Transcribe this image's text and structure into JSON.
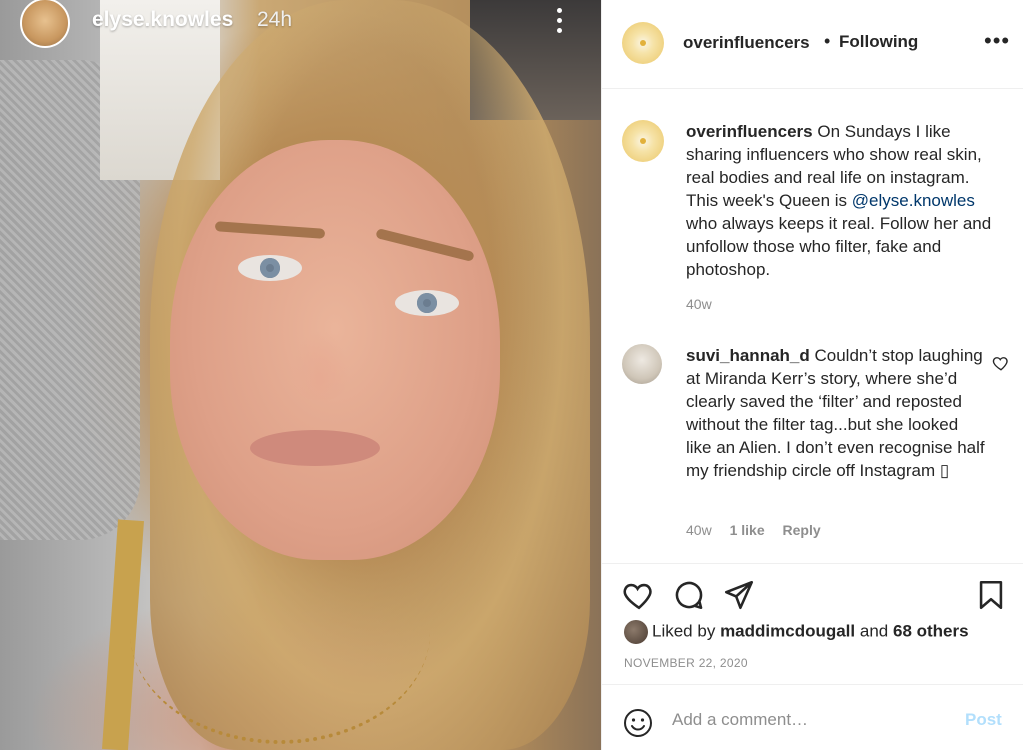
{
  "story": {
    "username": "elyse.knowles",
    "time": "24h",
    "more_icon": "more-vertical-icon"
  },
  "header": {
    "username": "overinfluencers",
    "separator": "•",
    "follow_state": "Following",
    "more_icon": "more-horizontal-icon"
  },
  "caption": {
    "username": "overinfluencers",
    "text_before": "On Sundays I like sharing influencers who show real skin, real bodies and real life on instagram. This week's Queen is",
    "mention": "@elyse.knowles",
    "text_after": "who always keeps it real. Follow her and unfollow those who filter, fake and photoshop.",
    "time": "40w"
  },
  "comment": {
    "username": "suvi_hannah_d",
    "text": "Couldn’t stop laughing at Miranda Kerr’s story, where she’d clearly saved the ‘filter’ and reposted without the filter tag...but she looked like an Alien. I don’t even recognise half my friendship circle off Instagram ",
    "emoji_glyph": "▯",
    "time": "40w",
    "likes": "1 like",
    "reply": "Reply",
    "like_icon": "heart-outline-icon"
  },
  "actions": {
    "like_icon": "heart-outline-icon",
    "comment_icon": "comment-bubble-icon",
    "share_icon": "paper-plane-icon",
    "save_icon": "bookmark-icon"
  },
  "likes": {
    "prefix": "Liked by",
    "user": "maddimcdougall",
    "conjunction": "and",
    "others": "68 others"
  },
  "date": "NOVEMBER 22, 2020",
  "add_comment": {
    "placeholder": "Add a comment…",
    "post_label": "Post",
    "emoji_icon": "smiley-icon"
  },
  "colors": {
    "text": "#262626",
    "muted": "#8e8e8e",
    "link": "#00376b",
    "post_disabled": "#b2dffc",
    "divider": "#efefef"
  }
}
